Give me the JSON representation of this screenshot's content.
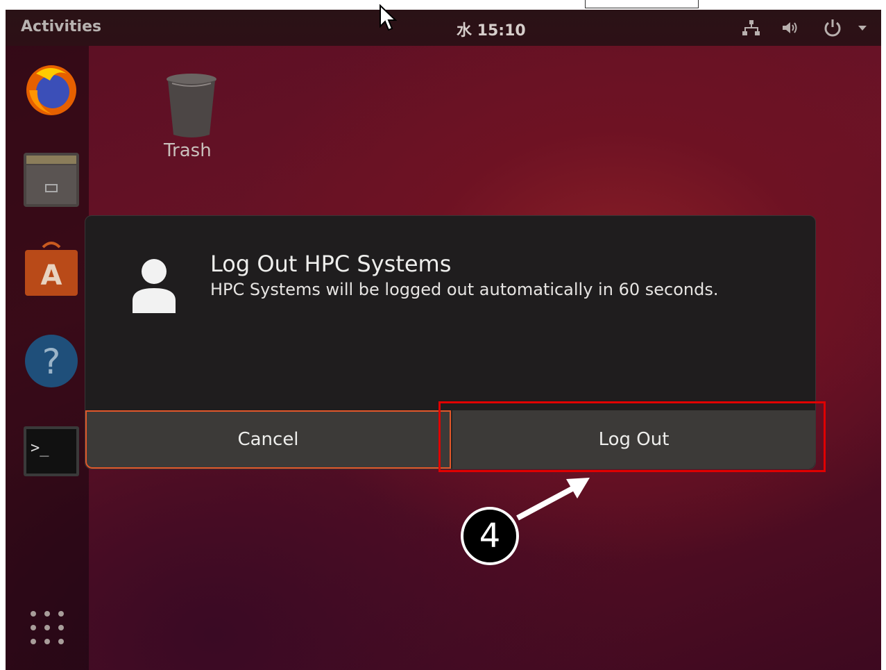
{
  "topbar": {
    "activities": "Activities",
    "clock": "水 15:10",
    "icons": [
      "network-icon",
      "volume-icon",
      "power-icon",
      "dropdown-arrow-icon"
    ]
  },
  "dock": {
    "apps": [
      "firefox-icon",
      "files-icon",
      "software-icon",
      "help-icon",
      "terminal-icon"
    ],
    "show_apps_icon": "show-applications-icon"
  },
  "desktop": {
    "trash_label": "Trash"
  },
  "dialog": {
    "title": "Log Out HPC Systems",
    "message": "HPC Systems will be logged out automatically in 60 seconds.",
    "cancel_label": "Cancel",
    "logout_label": "Log Out"
  },
  "annotation": {
    "step_number": "4",
    "highlight_color": "#e00000"
  },
  "colors": {
    "wallpaper": "#6b1326",
    "dialog_bg": "#1f1d1e",
    "button_bg": "#3c3a38",
    "focus_border": "#e2572a"
  }
}
